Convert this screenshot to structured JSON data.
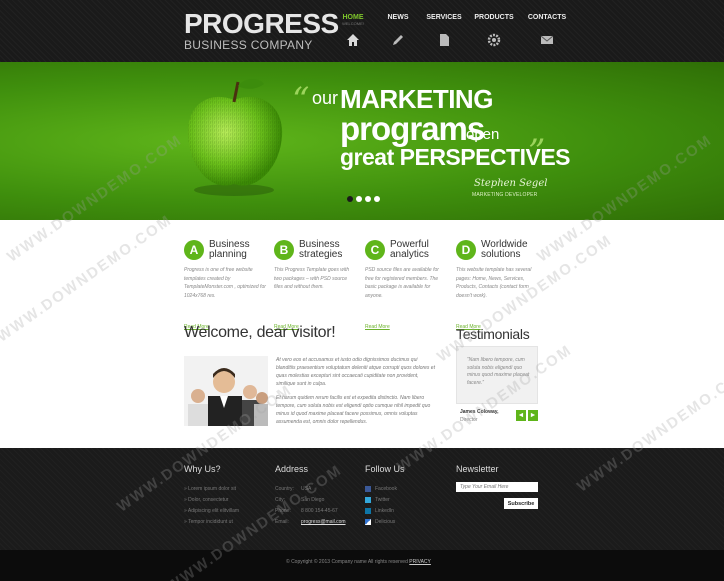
{
  "brand": {
    "title": "PROGRESS",
    "subtitle": "BUSINESS COMPANY"
  },
  "nav": [
    {
      "label": "HOME",
      "sub": "WELCOME!",
      "icon": "home-icon",
      "active": true
    },
    {
      "label": "NEWS",
      "sub": "",
      "icon": "pencil-icon",
      "active": false
    },
    {
      "label": "SERVICES",
      "sub": "",
      "icon": "document-icon",
      "active": false
    },
    {
      "label": "PRODUCTS",
      "sub": "",
      "icon": "gear-icon",
      "active": false
    },
    {
      "label": "CONTACTS",
      "sub": "",
      "icon": "envelope-icon",
      "active": false
    }
  ],
  "banner": {
    "our": "our",
    "marketing": "MARKETING",
    "programs": "programs",
    "open": "open",
    "great": "great PERSPECTIVES",
    "signature": "Stephen Segel",
    "role": "MARKETING DEVELOPER",
    "slides": 4,
    "active_slide": 0
  },
  "features": [
    {
      "letter": "A",
      "title": "Business planning",
      "text": "Progress is one of free website templates created by TemplateMonster.com , optimized for 1024x768 res.",
      "link": "Read More"
    },
    {
      "letter": "B",
      "title": "Business strategies",
      "text": "This Progress Template goes with two packages ‒ with PSD source files and without them.",
      "link": "Read More"
    },
    {
      "letter": "C",
      "title": "Powerful analytics",
      "text": "PSD source files are available for free for registered members. The basic package is available for anyone.",
      "link": "Read More"
    },
    {
      "letter": "D",
      "title": "Worldwide solutions",
      "text": "This website template has several pages: Home, News, Services, Products, Contacts (contact form doesn't work).",
      "link": "Read More"
    }
  ],
  "welcome": {
    "title": "Welcome, dear visitor!",
    "p1": "At vero eos et accusamus et iusto odio dignissimos ducimus qui blanditiis praesentium voluptatum deleniti atque corrupti quos dolores et quas molestias excepturi sint occaecati cupiditate non provident, similique sunt in culpa.",
    "p2": "Et harum quidem rerum facilis est et expedita distinctio. Nam libero tempore, cum soluta nobis est eligendi optio cumque nihil impedit quo minus id quod maxime placeat facere possimus, omnis voluptas assumenda est, omnis dolor repellendus."
  },
  "testimonials": {
    "title": "Testimonials",
    "quote": "“Nam libero tempore, cum soluta nobis eligendi quo minus quod maxime placeat facere.”",
    "name": "James Coloway,",
    "role": "Director",
    "prev": "◄",
    "next": "►"
  },
  "footer": {
    "why_title": "Why Us?",
    "why_items": [
      "Lorem ipsum dolor sit",
      "Dolor, consectetur",
      "Adipiscing elit elitvillam",
      "Tempor incididunt ut"
    ],
    "address_title": "Address",
    "address": [
      {
        "k": "Country:",
        "v": "USA"
      },
      {
        "k": "City:",
        "v": "San Diego"
      },
      {
        "k": "Phone:",
        "v": "8 800 154-45-67"
      },
      {
        "k": "Email:",
        "v": "progress@mail.com"
      }
    ],
    "follow_title": "Follow Us",
    "follow": [
      "Facebook",
      "Twitter",
      "LinkedIn",
      "Delicious"
    ],
    "newsletter_title": "Newsletter",
    "newsletter_placeholder": "Type Your Email Here",
    "subscribe": "Subscribe"
  },
  "copyright": {
    "text": "© Copyright © 2013 Company name All rights reserved ",
    "policy": "PRIVACY"
  },
  "watermark": "WWW.DOWNDEMO.COM",
  "colors": {
    "accent": "#5fb51a",
    "dark": "#1a1a1a"
  }
}
